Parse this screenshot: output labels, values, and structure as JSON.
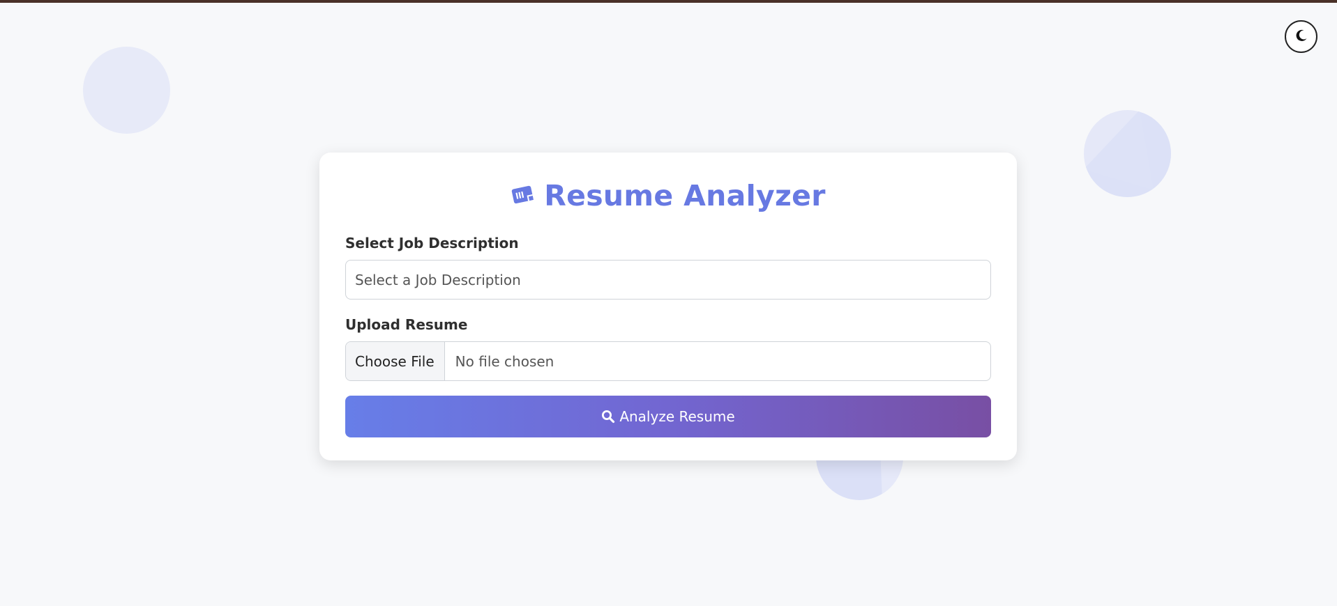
{
  "app": {
    "title": "Resume Analyzer"
  },
  "theme_toggle": {
    "icon": "moon-icon"
  },
  "form": {
    "job_label": "Select Job Description",
    "job_placeholder": "Select a Job Description",
    "upload_label": "Upload Resume",
    "choose_file": "Choose File",
    "file_status": "No file chosen",
    "submit_label": "Analyze Resume",
    "submit_icon": "search-icon"
  },
  "colors": {
    "accent": "#6779e2",
    "button_gradient_start": "#677ee8",
    "button_gradient_end": "#784fa4",
    "top_bar": "#4a3128"
  }
}
